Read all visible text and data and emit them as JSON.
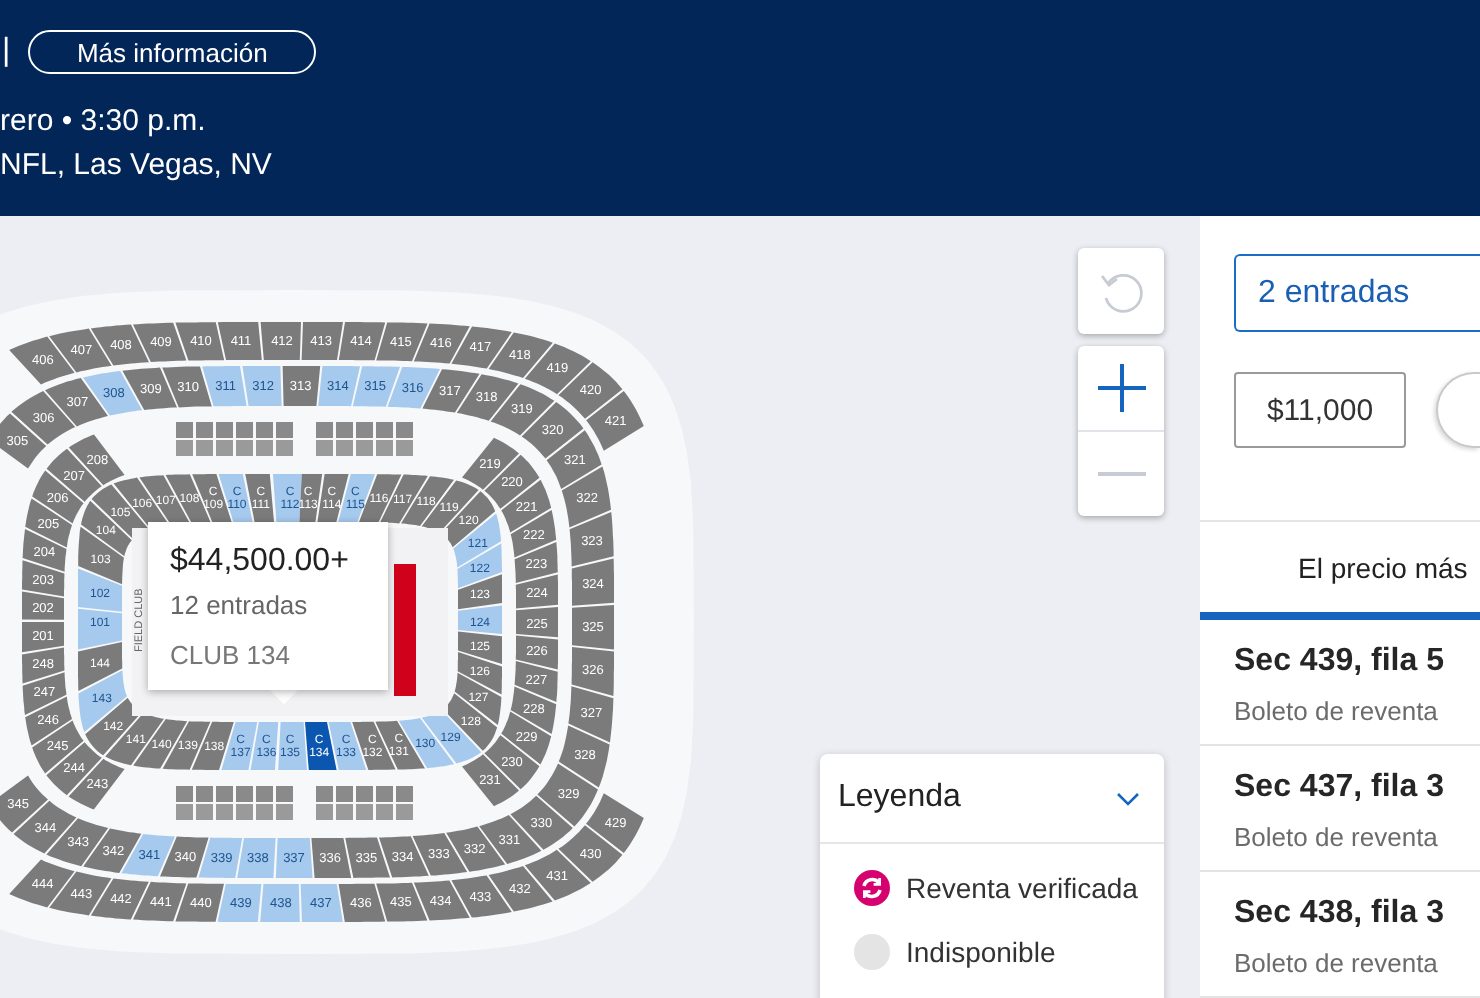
{
  "header": {
    "separator": "|",
    "info_button": "Más información",
    "date_line": "rero • 3:30 p.m.",
    "venue_line": "NFL, Las Vegas, NV"
  },
  "map": {
    "field_label": "FIELD CLUB",
    "tooltip": {
      "price": "$44,500.00+",
      "count": "12 entradas",
      "section": "CLUB 134"
    },
    "rings": [
      {
        "arcs": [
          {
            "sections": [
              {
                "label": "406",
                "available": false,
                "selected": false
              },
              {
                "label": "407",
                "available": false,
                "selected": false
              },
              {
                "label": "408",
                "available": false,
                "selected": false
              },
              {
                "label": "409",
                "available": false,
                "selected": false
              },
              {
                "label": "410",
                "available": false,
                "selected": false
              },
              {
                "label": "411",
                "available": false,
                "selected": false
              },
              {
                "label": "412",
                "available": false,
                "selected": false
              },
              {
                "label": "413",
                "available": false,
                "selected": false
              },
              {
                "label": "414",
                "available": false,
                "selected": false
              },
              {
                "label": "415",
                "available": false,
                "selected": false
              },
              {
                "label": "416",
                "available": false,
                "selected": false
              },
              {
                "label": "417",
                "available": false,
                "selected": false
              },
              {
                "label": "418",
                "available": false,
                "selected": false
              },
              {
                "label": "419",
                "available": false,
                "selected": false
              },
              {
                "label": "420",
                "available": false,
                "selected": false
              },
              {
                "label": "421",
                "available": false,
                "selected": false
              }
            ]
          },
          {
            "sections": [
              {
                "label": "444",
                "available": false,
                "selected": false
              },
              {
                "label": "443",
                "available": false,
                "selected": false
              },
              {
                "label": "442",
                "available": false,
                "selected": false
              },
              {
                "label": "441",
                "available": false,
                "selected": false
              },
              {
                "label": "440",
                "available": false,
                "selected": false
              },
              {
                "label": "439",
                "available": true,
                "selected": false
              },
              {
                "label": "438",
                "available": true,
                "selected": false
              },
              {
                "label": "437",
                "available": true,
                "selected": false
              },
              {
                "label": "436",
                "available": false,
                "selected": false
              },
              {
                "label": "435",
                "available": false,
                "selected": false
              },
              {
                "label": "434",
                "available": false,
                "selected": false
              },
              {
                "label": "433",
                "available": false,
                "selected": false
              },
              {
                "label": "432",
                "available": false,
                "selected": false
              },
              {
                "label": "431",
                "available": false,
                "selected": false
              },
              {
                "label": "430",
                "available": false,
                "selected": false
              },
              {
                "label": "429",
                "available": false,
                "selected": false
              }
            ]
          }
        ]
      },
      {
        "arcs": [
          {
            "sections": [
              {
                "label": "305",
                "available": false,
                "selected": false
              }
            ]
          },
          {
            "sections": [
              {
                "label": "306",
                "available": false,
                "selected": false
              },
              {
                "label": "307",
                "available": false,
                "selected": false
              },
              {
                "label": "308",
                "available": true,
                "selected": false
              },
              {
                "label": "309",
                "available": false,
                "selected": false
              },
              {
                "label": "310",
                "available": false,
                "selected": false
              },
              {
                "label": "311",
                "available": true,
                "selected": false
              },
              {
                "label": "312",
                "available": true,
                "selected": false
              },
              {
                "label": "313",
                "available": false,
                "selected": false
              },
              {
                "label": "314",
                "available": true,
                "selected": false
              },
              {
                "label": "315",
                "available": true,
                "selected": false
              },
              {
                "label": "316",
                "available": true,
                "selected": false
              },
              {
                "label": "317",
                "available": false,
                "selected": false
              },
              {
                "label": "318",
                "available": false,
                "selected": false
              },
              {
                "label": "319",
                "available": false,
                "selected": false
              },
              {
                "label": "320",
                "available": false,
                "selected": false
              },
              {
                "label": "321",
                "available": false,
                "selected": false
              }
            ]
          },
          {
            "sections": [
              {
                "label": "322",
                "available": false,
                "selected": false
              },
              {
                "label": "323",
                "available": false,
                "selected": false
              },
              {
                "label": "324",
                "available": false,
                "selected": false
              },
              {
                "label": "325",
                "available": false,
                "selected": false
              },
              {
                "label": "326",
                "available": false,
                "selected": false
              },
              {
                "label": "327",
                "available": false,
                "selected": false
              },
              {
                "label": "328",
                "available": false,
                "selected": false
              },
              {
                "label": "329",
                "available": false,
                "selected": false
              }
            ]
          },
          {
            "sections": [
              {
                "label": "345",
                "available": false,
                "selected": false
              },
              {
                "label": "344",
                "available": false,
                "selected": false
              },
              {
                "label": "343",
                "available": false,
                "selected": false
              },
              {
                "label": "342",
                "available": false,
                "selected": false
              },
              {
                "label": "341",
                "available": true,
                "selected": false
              },
              {
                "label": "340",
                "available": false,
                "selected": false
              },
              {
                "label": "339",
                "available": true,
                "selected": false
              },
              {
                "label": "338",
                "available": true,
                "selected": false
              },
              {
                "label": "337",
                "available": true,
                "selected": false
              },
              {
                "label": "336",
                "available": false,
                "selected": false
              },
              {
                "label": "335",
                "available": false,
                "selected": false
              },
              {
                "label": "334",
                "available": false,
                "selected": false
              },
              {
                "label": "333",
                "available": false,
                "selected": false
              },
              {
                "label": "332",
                "available": false,
                "selected": false
              },
              {
                "label": "331",
                "available": false,
                "selected": false
              },
              {
                "label": "330",
                "available": false,
                "selected": false
              }
            ]
          }
        ]
      },
      {
        "arcs": [
          {
            "sections": [
              {
                "label": "208",
                "available": false,
                "selected": false
              },
              {
                "label": "207",
                "available": false,
                "selected": false
              },
              {
                "label": "206",
                "available": false,
                "selected": false
              },
              {
                "label": "205",
                "available": false,
                "selected": false
              },
              {
                "label": "204",
                "available": false,
                "selected": false
              },
              {
                "label": "203",
                "available": false,
                "selected": false
              },
              {
                "label": "202",
                "available": false,
                "selected": false
              },
              {
                "label": "201",
                "available": false,
                "selected": false
              },
              {
                "label": "248",
                "available": false,
                "selected": false
              },
              {
                "label": "247",
                "available": false,
                "selected": false
              },
              {
                "label": "246",
                "available": false,
                "selected": false
              },
              {
                "label": "245",
                "available": false,
                "selected": false
              },
              {
                "label": "244",
                "available": false,
                "selected": false
              },
              {
                "label": "243",
                "available": false,
                "selected": false
              }
            ]
          },
          {
            "sections": [
              {
                "label": "219",
                "available": false,
                "selected": false
              },
              {
                "label": "220",
                "available": false,
                "selected": false
              },
              {
                "label": "221",
                "available": false,
                "selected": false
              },
              {
                "label": "222",
                "available": false,
                "selected": false
              },
              {
                "label": "223",
                "available": false,
                "selected": false
              },
              {
                "label": "224",
                "available": false,
                "selected": false
              },
              {
                "label": "225",
                "available": false,
                "selected": false
              },
              {
                "label": "226",
                "available": false,
                "selected": false
              },
              {
                "label": "227",
                "available": false,
                "selected": false
              },
              {
                "label": "228",
                "available": false,
                "selected": false
              },
              {
                "label": "229",
                "available": false,
                "selected": false
              },
              {
                "label": "230",
                "available": false,
                "selected": false
              },
              {
                "label": "231",
                "available": false,
                "selected": false
              }
            ]
          }
        ]
      },
      {
        "arcs": [
          {
            "sections": [
              {
                "label": "104",
                "available": false,
                "selected": false
              },
              {
                "label": "105",
                "available": false,
                "selected": false
              },
              {
                "label": "106",
                "available": false,
                "selected": false
              },
              {
                "label": "107",
                "available": false,
                "selected": false
              },
              {
                "label": "108",
                "available": false,
                "selected": false
              },
              {
                "prefix": "C",
                "label": "109",
                "available": false,
                "selected": false
              },
              {
                "prefix": "C",
                "label": "110",
                "available": true,
                "selected": false
              },
              {
                "prefix": "C",
                "label": "111",
                "available": false,
                "selected": false
              },
              {
                "prefix": "C",
                "label": "112",
                "available": true,
                "selected": false
              },
              {
                "prefix": "C",
                "label": "113",
                "available": false,
                "selected": false
              },
              {
                "prefix": "C",
                "label": "114",
                "available": false,
                "selected": false
              },
              {
                "prefix": "C",
                "label": "115",
                "available": true,
                "selected": false
              },
              {
                "label": "116",
                "available": false,
                "selected": false
              },
              {
                "label": "117",
                "available": false,
                "selected": false
              },
              {
                "label": "118",
                "available": false,
                "selected": false
              },
              {
                "label": "119",
                "available": false,
                "selected": false
              },
              {
                "label": "120",
                "available": false,
                "selected": false
              }
            ]
          },
          {
            "sections": [
              {
                "label": "121",
                "available": true,
                "selected": false
              },
              {
                "label": "122",
                "available": true,
                "selected": false
              },
              {
                "label": "123",
                "available": false,
                "selected": false
              },
              {
                "label": "124",
                "available": true,
                "selected": false
              },
              {
                "label": "125",
                "available": false,
                "selected": false
              },
              {
                "label": "126",
                "available": false,
                "selected": false
              },
              {
                "label": "127",
                "available": false,
                "selected": false
              },
              {
                "label": "128",
                "available": false,
                "selected": false
              }
            ]
          },
          {
            "sections": [
              {
                "label": "142",
                "available": false,
                "selected": false
              },
              {
                "label": "141",
                "available": false,
                "selected": false
              },
              {
                "label": "140",
                "available": false,
                "selected": false
              },
              {
                "label": "139",
                "available": false,
                "selected": false
              },
              {
                "label": "138",
                "available": false,
                "selected": false
              },
              {
                "prefix": "C",
                "label": "137",
                "available": true,
                "selected": false
              },
              {
                "prefix": "C",
                "label": "136",
                "available": true,
                "selected": false
              },
              {
                "prefix": "C",
                "label": "135",
                "available": true,
                "selected": false
              },
              {
                "prefix": "C",
                "label": "134",
                "available": true,
                "selected": true
              },
              {
                "prefix": "C",
                "label": "133",
                "available": true,
                "selected": false
              },
              {
                "prefix": "C",
                "label": "132",
                "available": false,
                "selected": false
              },
              {
                "prefix": "C",
                "label": "131",
                "available": false,
                "selected": false
              },
              {
                "label": "130",
                "available": true,
                "selected": false
              },
              {
                "label": "129",
                "available": true,
                "selected": false
              }
            ]
          },
          {
            "sections": [
              {
                "label": "103",
                "available": false,
                "selected": false
              },
              {
                "label": "102",
                "available": true,
                "selected": false
              },
              {
                "label": "101",
                "available": true,
                "selected": false
              },
              {
                "label": "144",
                "available": false,
                "selected": false
              },
              {
                "label": "143",
                "available": true,
                "selected": false
              }
            ]
          }
        ]
      }
    ]
  },
  "map_controls": {
    "reset": {
      "disabled": true
    },
    "zoom_in": {
      "disabled": false
    },
    "zoom_out": {
      "disabled": true
    }
  },
  "legend": {
    "title": "Leyenda",
    "expanded": true,
    "items": [
      {
        "kind": "verified",
        "label": "Reventa verificada"
      },
      {
        "kind": "unavailable",
        "label": "Indisponible"
      }
    ]
  },
  "panel": {
    "quantity": {
      "value": "2 entradas"
    },
    "min_price": {
      "value": "$11,000"
    },
    "tabs": [
      {
        "label": "El precio más",
        "selected": true
      }
    ],
    "listings": [
      {
        "section": "Sec 439, fila 5",
        "type": "Boleto de reventa"
      },
      {
        "section": "Sec 437, fila 3",
        "type": "Boleto de reventa"
      },
      {
        "section": "Sec 438, fila 3",
        "type": "Boleto de reventa"
      }
    ]
  }
}
